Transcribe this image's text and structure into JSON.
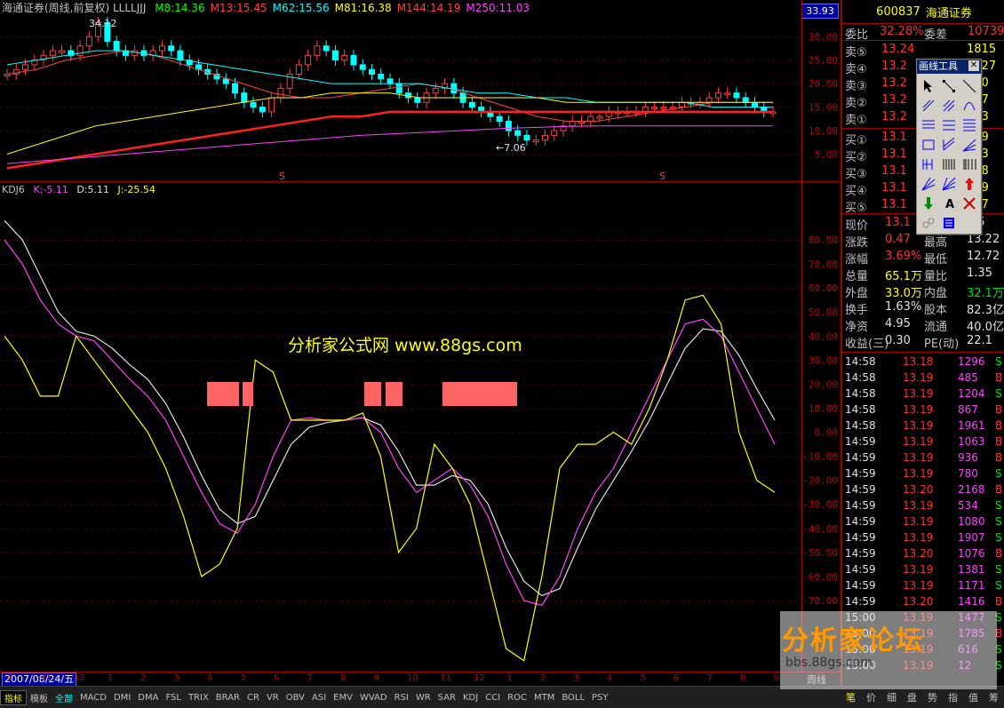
{
  "main_chart": {
    "title": "海通证券(周线,前复权) LLLLJJJ",
    "ma_legend": [
      {
        "label": "M8:14.36",
        "color": "#00ff00"
      },
      {
        "label": "M13:15.45",
        "color": "#ff4040"
      },
      {
        "label": "M62:15.56",
        "color": "#00ffff"
      },
      {
        "label": "M81:16.38",
        "color": "#ffff00"
      },
      {
        "label": "M144:14.19",
        "color": "#ff4040"
      },
      {
        "label": "M250:11.03",
        "color": "#ff40ff"
      }
    ],
    "current_price_box": "33.93",
    "high_marker": "34.12",
    "low_marker": "←7.06",
    "y_labels": [
      "30.00",
      "25.00",
      "20.00",
      "15.00",
      "10.00",
      "5.00"
    ],
    "s_marker": "S"
  },
  "kdj": {
    "title": "KDJ6",
    "k_label": "K:-5.11",
    "d_label": "D:5.11",
    "j_label": "J:-25.54",
    "y_labels": [
      "80.00",
      "70.00",
      "60.00",
      "50.00",
      "40.00",
      "30.00",
      "20.00",
      "10.00",
      "0.00",
      "-10.00",
      "-20.00",
      "-30.00",
      "-40.00",
      "-50.00",
      "-60.00",
      "-70.00"
    ],
    "k": [
      80,
      70,
      55,
      45,
      40,
      38,
      30,
      22,
      15,
      5,
      -10,
      -25,
      -38,
      -42,
      -30,
      -10,
      5,
      6,
      5,
      5,
      6,
      0,
      -15,
      -25,
      -20,
      -15,
      -22,
      -35,
      -55,
      -70,
      -72,
      -60,
      -40,
      -25,
      -15,
      0,
      15,
      30,
      45,
      47,
      40,
      25,
      10,
      -5
    ],
    "d": [
      88,
      80,
      65,
      50,
      42,
      40,
      35,
      28,
      22,
      12,
      -2,
      -18,
      -32,
      -38,
      -35,
      -20,
      -5,
      2,
      4,
      5,
      6,
      3,
      -8,
      -22,
      -22,
      -18,
      -20,
      -30,
      -48,
      -62,
      -68,
      -65,
      -48,
      -32,
      -20,
      -8,
      5,
      20,
      35,
      43,
      42,
      32,
      18,
      5
    ],
    "j": [
      40,
      30,
      15,
      15,
      40,
      30,
      20,
      10,
      0,
      -15,
      -35,
      -60,
      -55,
      -40,
      30,
      25,
      5,
      5,
      5,
      5,
      8,
      -10,
      -50,
      -40,
      -5,
      -15,
      -30,
      -60,
      -90,
      -95,
      -60,
      -15,
      -5,
      -5,
      0,
      -5,
      10,
      30,
      55,
      57,
      45,
      0,
      -20,
      -25
    ]
  },
  "watermark_center": "分析家公式网 www.88gs.com",
  "forum_watermark": {
    "title": "分析家论坛",
    "url": "bbs.88gs.com"
  },
  "xaxis": {
    "date": "2007/08/24/五",
    "ticks": [
      "2",
      "11",
      "12",
      "1",
      "2",
      "3",
      "4",
      "5",
      "6",
      "7",
      "8",
      "9",
      "10",
      "11",
      "12",
      "1",
      "2",
      "3",
      "4",
      "5",
      "6",
      "7",
      "8",
      "9"
    ],
    "period": "周线"
  },
  "bottom_tabs": [
    "指标",
    "模板",
    "全部",
    "MACD",
    "DMI",
    "DMA",
    "FSL",
    "TRIX",
    "BRAR",
    "CR",
    "VR",
    "OBV",
    "ASI",
    "EMV",
    "WVAD",
    "RSI",
    "WR",
    "SAR",
    "KDJ",
    "CCI",
    "ROC",
    "MTM",
    "BOLL",
    "PSY"
  ],
  "right_panel": {
    "code": "600837",
    "name": "海通证券",
    "weibi_label": "委比",
    "weibi_value": "32.28%",
    "weicha_label": "委差",
    "weicha_value": "10739",
    "sell": [
      {
        "label": "卖⑤",
        "price": "13.24",
        "vol": "1815"
      },
      {
        "label": "卖④",
        "price": "13.2",
        "vol": "1427"
      },
      {
        "label": "卖③",
        "price": "13.2",
        "vol": "190"
      },
      {
        "label": "卖②",
        "price": "13.2",
        "vol": "807"
      },
      {
        "label": "卖①",
        "price": "13.2",
        "vol": "313"
      }
    ],
    "buy": [
      {
        "label": "买①",
        "price": "13.1",
        "vol": "219"
      },
      {
        "label": "买②",
        "price": "13.1",
        "vol": "073"
      },
      {
        "label": "买③",
        "price": "13.1",
        "vol": "448"
      },
      {
        "label": "买④",
        "price": "13.1",
        "vol": "969"
      },
      {
        "label": "买⑤",
        "price": "13.1",
        "vol": "297"
      }
    ],
    "quote": [
      {
        "l1": "现价",
        "v1": "13.1",
        "l2": "",
        "v2": ".85"
      },
      {
        "l1": "涨跌",
        "v1": "0.47",
        "l2": "最高",
        "v2": "13.22"
      },
      {
        "l1": "涨幅",
        "v1": "3.69%",
        "l2": "最低",
        "v2": "12.72"
      },
      {
        "l1": "总量",
        "v1": "65.1万",
        "l2": "量比",
        "v2": "1.35"
      },
      {
        "l1": "外盘",
        "v1": "33.0万",
        "l2": "内盘",
        "v2": "32.1万"
      },
      {
        "l1": "换手",
        "v1": "1.63%",
        "l2": "股本",
        "v2": "82.3亿"
      },
      {
        "l1": "净资",
        "v1": "4.95",
        "l2": "流通",
        "v2": "40.0亿"
      },
      {
        "l1": "收益(三)",
        "v1": "0.30",
        "l2": "PE(动)",
        "v2": "22.1"
      }
    ],
    "trades": [
      {
        "t": "14:58",
        "p": "13.18",
        "v": "1296",
        "s": "S"
      },
      {
        "t": "14:58",
        "p": "13.19",
        "v": "485",
        "s": "B"
      },
      {
        "t": "14:58",
        "p": "13.19",
        "v": "1204",
        "s": "S"
      },
      {
        "t": "14:58",
        "p": "13.19",
        "v": "867",
        "s": "B"
      },
      {
        "t": "14:58",
        "p": "13.19",
        "v": "1961",
        "s": "B"
      },
      {
        "t": "14:59",
        "p": "13.19",
        "v": "1063",
        "s": "B"
      },
      {
        "t": "14:59",
        "p": "13.19",
        "v": "936",
        "s": "B"
      },
      {
        "t": "14:59",
        "p": "13.19",
        "v": "780",
        "s": "S"
      },
      {
        "t": "14:59",
        "p": "13.20",
        "v": "2168",
        "s": "B"
      },
      {
        "t": "14:59",
        "p": "13.19",
        "v": "534",
        "s": "S"
      },
      {
        "t": "14:59",
        "p": "13.19",
        "v": "1080",
        "s": "S"
      },
      {
        "t": "14:59",
        "p": "13.19",
        "v": "1907",
        "s": "S"
      },
      {
        "t": "14:59",
        "p": "13.20",
        "v": "1076",
        "s": "B"
      },
      {
        "t": "14:59",
        "p": "13.19",
        "v": "1381",
        "s": "S"
      },
      {
        "t": "14:59",
        "p": "13.19",
        "v": "1171",
        "s": "S"
      },
      {
        "t": "14:59",
        "p": "13.20",
        "v": "1416",
        "s": "B"
      },
      {
        "t": "15:00",
        "p": "13.19",
        "v": "1477",
        "s": "S"
      },
      {
        "t": "15:00",
        "p": "13.19",
        "v": "1785",
        "s": "B"
      },
      {
        "t": "15:00",
        "p": "13.19",
        "v": "616",
        "s": "S"
      },
      {
        "t": "15:00",
        "p": "13.19",
        "v": "12",
        "s": "S"
      }
    ],
    "tabs": [
      "笔",
      "价",
      "细",
      "盘",
      "势",
      "指",
      "值",
      "筹"
    ]
  },
  "toolbox": {
    "title": "画线工具",
    "close": "✕"
  }
}
